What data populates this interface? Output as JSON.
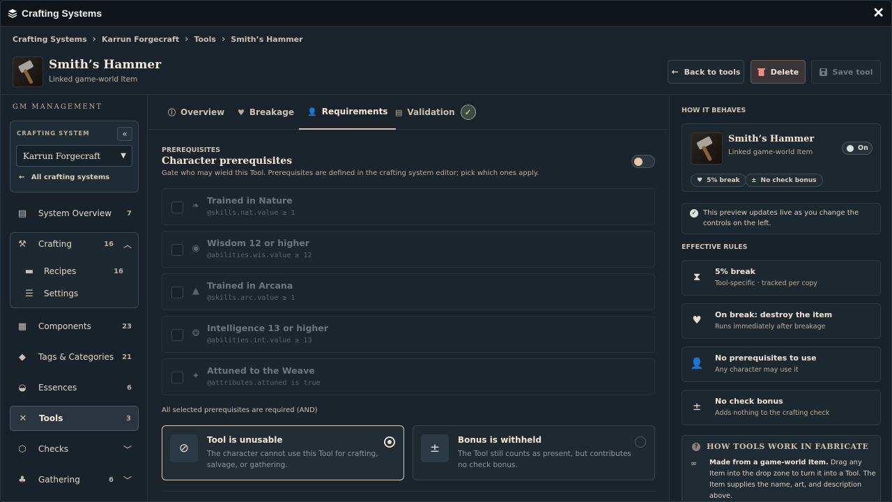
{
  "window": {
    "title": "Crafting Systems",
    "close_glyph": "✕"
  },
  "breadcrumb": [
    "Crafting Systems",
    "Karrun Forgecraft",
    "Tools",
    "Smith’s Hammer"
  ],
  "header": {
    "name": "Smith’s Hammer",
    "subtitle": "Linked game-world Item",
    "back_label": "Back to tools",
    "delete_label": "Delete",
    "save_label": "Save tool"
  },
  "sidebar": {
    "section_title": "GM MANAGEMENT",
    "crafting_system_label": "CRAFTING SYSTEM",
    "selected_system": "Karrun Forgecraft",
    "all_systems_link": "All crafting systems",
    "items": [
      {
        "label": "System Overview",
        "count": "7",
        "icon": "clipboard-icon"
      },
      {
        "label": "Crafting",
        "count": "16",
        "icon": "hammer-icon"
      },
      {
        "label": "Recipes",
        "count": "16",
        "icon": "scroll-icon"
      },
      {
        "label": "Settings",
        "count": "",
        "icon": "sliders-icon"
      },
      {
        "label": "Components",
        "count": "23",
        "icon": "boxes-icon"
      },
      {
        "label": "Tags & Categories",
        "count": "21",
        "icon": "tags-icon"
      },
      {
        "label": "Essences",
        "count": "6",
        "icon": "mortar-icon"
      },
      {
        "label": "Tools",
        "count": "3",
        "icon": "tools-icon"
      },
      {
        "label": "Checks",
        "count": "",
        "icon": "dice-icon"
      },
      {
        "label": "Gathering",
        "count": "6",
        "icon": "seedling-icon"
      }
    ]
  },
  "tabs": [
    {
      "label": "Overview",
      "icon": "info-icon"
    },
    {
      "label": "Breakage",
      "icon": "heart-crack-icon"
    },
    {
      "label": "Requirements",
      "icon": "user-lock-icon",
      "active": true
    },
    {
      "label": "Validation",
      "icon": "clipboard-check-icon"
    }
  ],
  "prerequisites": {
    "caption": "PREREQUISITES",
    "title": "Character prerequisites",
    "description": "Gate who may wield this Tool. Prerequisites are defined in the crafting system editor; pick which ones apply.",
    "toggle_on": false,
    "items": [
      {
        "title": "Trained in Nature",
        "formula": "@skills.nat.value ≥ 1",
        "icon": "leaf-icon"
      },
      {
        "title": "Wisdom 12 or higher",
        "formula": "@abilities.wis.value ≥ 12",
        "icon": "eye-icon"
      },
      {
        "title": "Trained in Arcana",
        "formula": "@skills.arc.value ≥ 1",
        "icon": "wizard-hat-icon"
      },
      {
        "title": "Intelligence 13 or higher",
        "formula": "@abilities.int.value ≥ 13",
        "icon": "brain-icon"
      },
      {
        "title": "Attuned to the Weave",
        "formula": "@attributes.attuned is true",
        "icon": "magic-wand-icon"
      }
    ],
    "and_note": "All selected prerequisites are required (AND)",
    "options": [
      {
        "title": "Tool is unusable",
        "description": "The character cannot use this Tool for crafting, salvage, or gathering.",
        "icon": "ban-icon",
        "selected": true
      },
      {
        "title": "Bonus is withheld",
        "description": "The Tool still counts as present, but contributes no check bonus.",
        "icon": "plus-minus-icon",
        "selected": false
      }
    ]
  },
  "right_panel": {
    "how_behaves_title": "HOW IT BEHAVES",
    "preview": {
      "name": "Smith’s Hammer",
      "subtitle": "Linked game-world Item",
      "on_label": "On",
      "badges": [
        "5% break",
        "No check bonus"
      ]
    },
    "info_text": "This preview updates live as you change the controls on the left.",
    "effective_rules_title": "EFFECTIVE RULES",
    "rules": [
      {
        "title": "5% break",
        "description": "Tool-specific · tracked per copy",
        "icon": "hourglass-icon"
      },
      {
        "title": "On break: destroy the item",
        "description": "Runs immediately after breakage",
        "icon": "heart-crack-icon"
      },
      {
        "title": "No prerequisites to use",
        "description": "Any character may use it",
        "icon": "user-lock-icon"
      },
      {
        "title": "No check bonus",
        "description": "Adds nothing to the crafting check",
        "icon": "plus-minus-icon"
      }
    ],
    "how_tools": {
      "title": "HOW TOOLS WORK IN FABRICATE",
      "lead": "Made from a game-world Item.",
      "body": " Drag any Item into the drop zone to turn it into a Tool. The Item supplies the name, art, and description above."
    }
  }
}
